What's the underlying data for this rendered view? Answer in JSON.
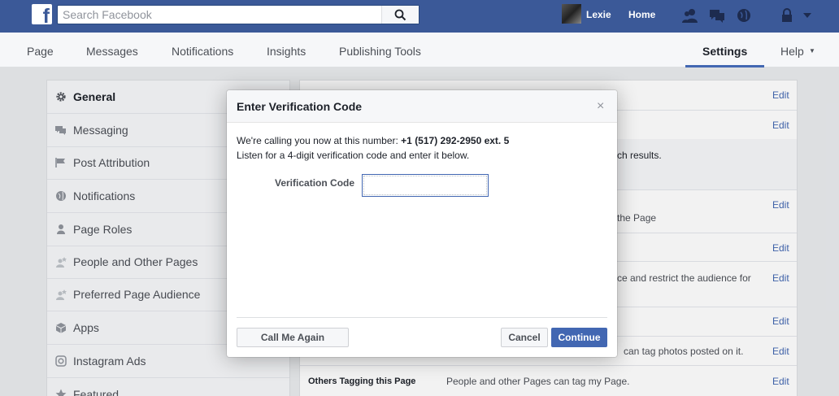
{
  "topbar": {
    "logo": "f",
    "search_placeholder": "Search Facebook",
    "user_name": "Lexie",
    "home_label": "Home",
    "brand_color": "#3b5998"
  },
  "page_nav": {
    "tabs": [
      {
        "label": "Page"
      },
      {
        "label": "Messages"
      },
      {
        "label": "Notifications"
      },
      {
        "label": "Insights"
      },
      {
        "label": "Publishing Tools"
      },
      {
        "label": "Settings",
        "active": true
      },
      {
        "label": "Help"
      }
    ],
    "help_caret": "▼"
  },
  "left_menu": {
    "items": [
      {
        "label": "General",
        "icon": "gear-icon",
        "active": true
      },
      {
        "label": "Messaging",
        "icon": "chat-icon"
      },
      {
        "label": "Post Attribution",
        "icon": "flag-icon"
      },
      {
        "label": "Notifications",
        "icon": "globe-icon"
      },
      {
        "label": "Page Roles",
        "icon": "person-icon"
      },
      {
        "label": "People and Other Pages",
        "icon": "person-star-icon"
      },
      {
        "label": "Preferred Page Audience",
        "icon": "person-star-icon"
      },
      {
        "label": "Apps",
        "icon": "cube-icon"
      },
      {
        "label": "Instagram Ads",
        "icon": "instagram-icon"
      },
      {
        "label": "Featured",
        "icon": "star-icon"
      }
    ]
  },
  "right_panel": {
    "edit_label": "Edit",
    "fragments": {
      "search_results": "ch results.",
      "the_page": "the Page",
      "restrict_audience": "ce and restrict the audience for",
      "tag_photos": "can tag photos posted on it.",
      "others_tagging_label": "Others Tagging this Page",
      "others_tagging_value": "People and other Pages can tag my Page."
    }
  },
  "dialog": {
    "title": "Enter Verification Code",
    "close": "×",
    "calling_text": "We're calling you now at this number: ",
    "phone": "+1 (517) 292-2950 ext. 5",
    "instruction": "Listen for a 4-digit verification code and enter it below.",
    "field_label": "Verification Code",
    "field_value": "",
    "call_again_button": "Call Me Again",
    "cancel_button": "Cancel",
    "continue_button": "Continue"
  }
}
